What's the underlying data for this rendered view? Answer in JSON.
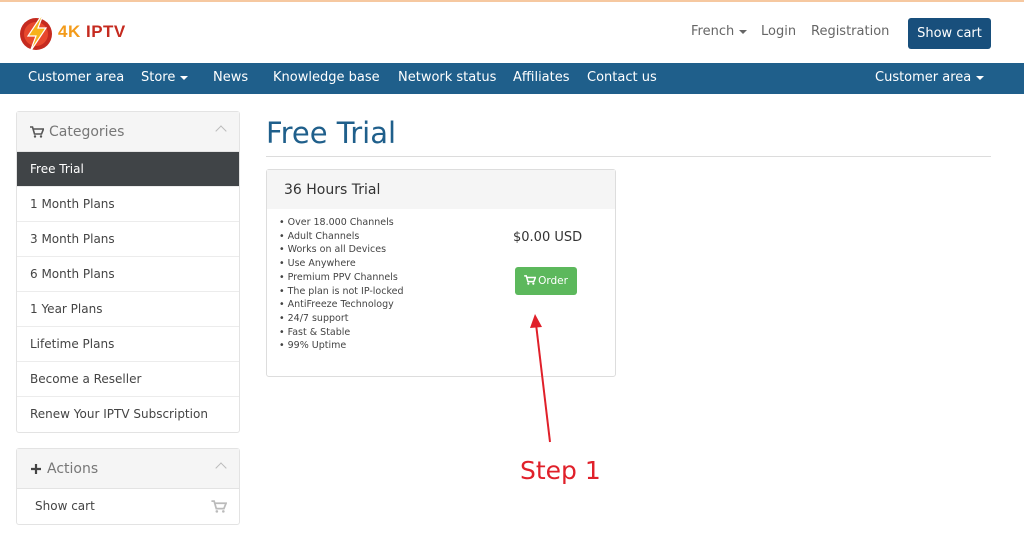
{
  "brand": {
    "logo_part1": "4K",
    "logo_part2": "IPTV"
  },
  "header": {
    "language_label": "French",
    "login_label": "Login",
    "registration_label": "Registration",
    "show_cart_label": "Show cart"
  },
  "navbar": {
    "items": [
      {
        "label": "Customer area"
      },
      {
        "label": "Store"
      },
      {
        "label": "News"
      },
      {
        "label": "Knowledge base"
      },
      {
        "label": "Network status"
      },
      {
        "label": "Affiliates"
      },
      {
        "label": "Contact us"
      }
    ],
    "right_label": "Customer area"
  },
  "sidebar": {
    "categories_title": "Categories",
    "categories": [
      {
        "label": "Free Trial",
        "active": true
      },
      {
        "label": "1 Month Plans"
      },
      {
        "label": "3 Month Plans"
      },
      {
        "label": "6 Month Plans"
      },
      {
        "label": "1 Year Plans"
      },
      {
        "label": "Lifetime Plans"
      },
      {
        "label": "Become a Reseller"
      },
      {
        "label": "Renew Your IPTV Subscription"
      }
    ],
    "actions_title": "Actions",
    "actions": [
      {
        "label": "Show cart"
      }
    ]
  },
  "main": {
    "page_title": "Free Trial",
    "product": {
      "name": "36 Hours Trial",
      "features": [
        "• Over 18.000 Channels",
        "• Adult Channels",
        "• Works on all Devices",
        "• Use Anywhere",
        "• Premium PPV Channels",
        "• The plan is not IP-locked",
        "• AntiFreeze Technology",
        "• 24/7 support",
        "• Fast & Stable",
        "• 99% Uptime"
      ],
      "price": "$0.00 USD",
      "order_label": "Order"
    }
  },
  "annotation": {
    "step_label": "Step 1"
  },
  "colors": {
    "primary": "#1f5f8b",
    "dark_button": "#184f7c",
    "success": "#5cb85c",
    "annotation": "#e0202a",
    "active_item": "#404447"
  }
}
